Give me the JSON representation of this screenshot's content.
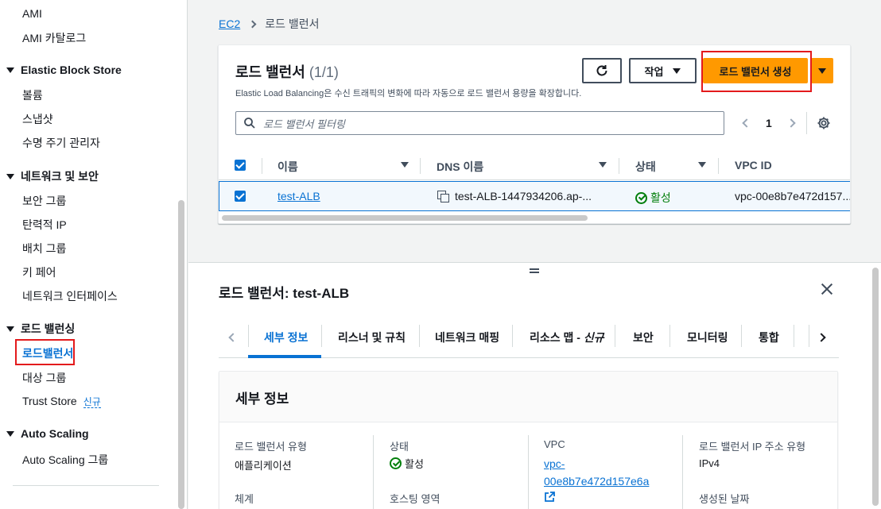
{
  "sidebar": {
    "items": [
      {
        "label": "AMI"
      },
      {
        "label": "AMI 카탈로그"
      },
      {
        "section": "Elastic Block Store"
      },
      {
        "label": "볼륨"
      },
      {
        "label": "스냅샷"
      },
      {
        "label": "수명 주기 관리자"
      },
      {
        "section": "네트워크 및 보안"
      },
      {
        "label": "보안 그룹"
      },
      {
        "label": "탄력적 IP"
      },
      {
        "label": "배치 그룹"
      },
      {
        "label": "키 페어"
      },
      {
        "label": "네트워크 인터페이스"
      },
      {
        "section": "로드 밸런싱"
      },
      {
        "label": "로드밸런서"
      },
      {
        "label": "대상 그룹"
      },
      {
        "label": "Trust Store"
      },
      {
        "section": "Auto Scaling"
      },
      {
        "label": "Auto Scaling 그룹"
      }
    ],
    "new_tag": "신규"
  },
  "breadcrumb": {
    "root": "EC2",
    "current": "로드 밸런서"
  },
  "panel": {
    "title": "로드 밸런서",
    "count": "(1/1)",
    "description": "Elastic Load Balancing은 수신 트래픽의 변화에 따라 자동으로 로드 밸런서 용량을 확장합니다.",
    "actions_label": "작업",
    "create_label": "로드 밸런서 생성",
    "search_placeholder": "로드 밸런서 필터링",
    "page": "1",
    "columns": [
      "이름",
      "DNS 이름",
      "상태",
      "VPC ID"
    ],
    "row": {
      "name": "test-ALB",
      "dns": "test-ALB-1447934206.ap-...",
      "status": "활성",
      "vpc": "vpc-00e8b7e472d157..."
    }
  },
  "details": {
    "title": "로드 밸런서: test-ALB",
    "tabs": [
      "세부 정보",
      "리스너 및 규칙",
      "네트워크 매핑",
      "리소스 맵 - ",
      "신규",
      "보안",
      "모니터링",
      "통합"
    ],
    "section_title": "세부 정보",
    "fields": {
      "type_label": "로드 밸런서 유형",
      "type_value": "애플리케이션",
      "status_label": "상태",
      "status_value": "활성",
      "vpc_label": "VPC",
      "vpc_value_line1": "vpc-",
      "vpc_value_line2": "00e8b7e472d157e6a",
      "ip_label": "로드 밸런서 IP 주소 유형",
      "ip_value": "IPv4",
      "scheme_label": "체계",
      "hosted_zone_label": "호스팅 영역",
      "created_label": "생성된 날짜"
    }
  },
  "colors": {
    "accent": "#0972d3",
    "primary_button": "#ff9900",
    "success": "#037f0c",
    "highlight_box": "#e31a1c"
  }
}
